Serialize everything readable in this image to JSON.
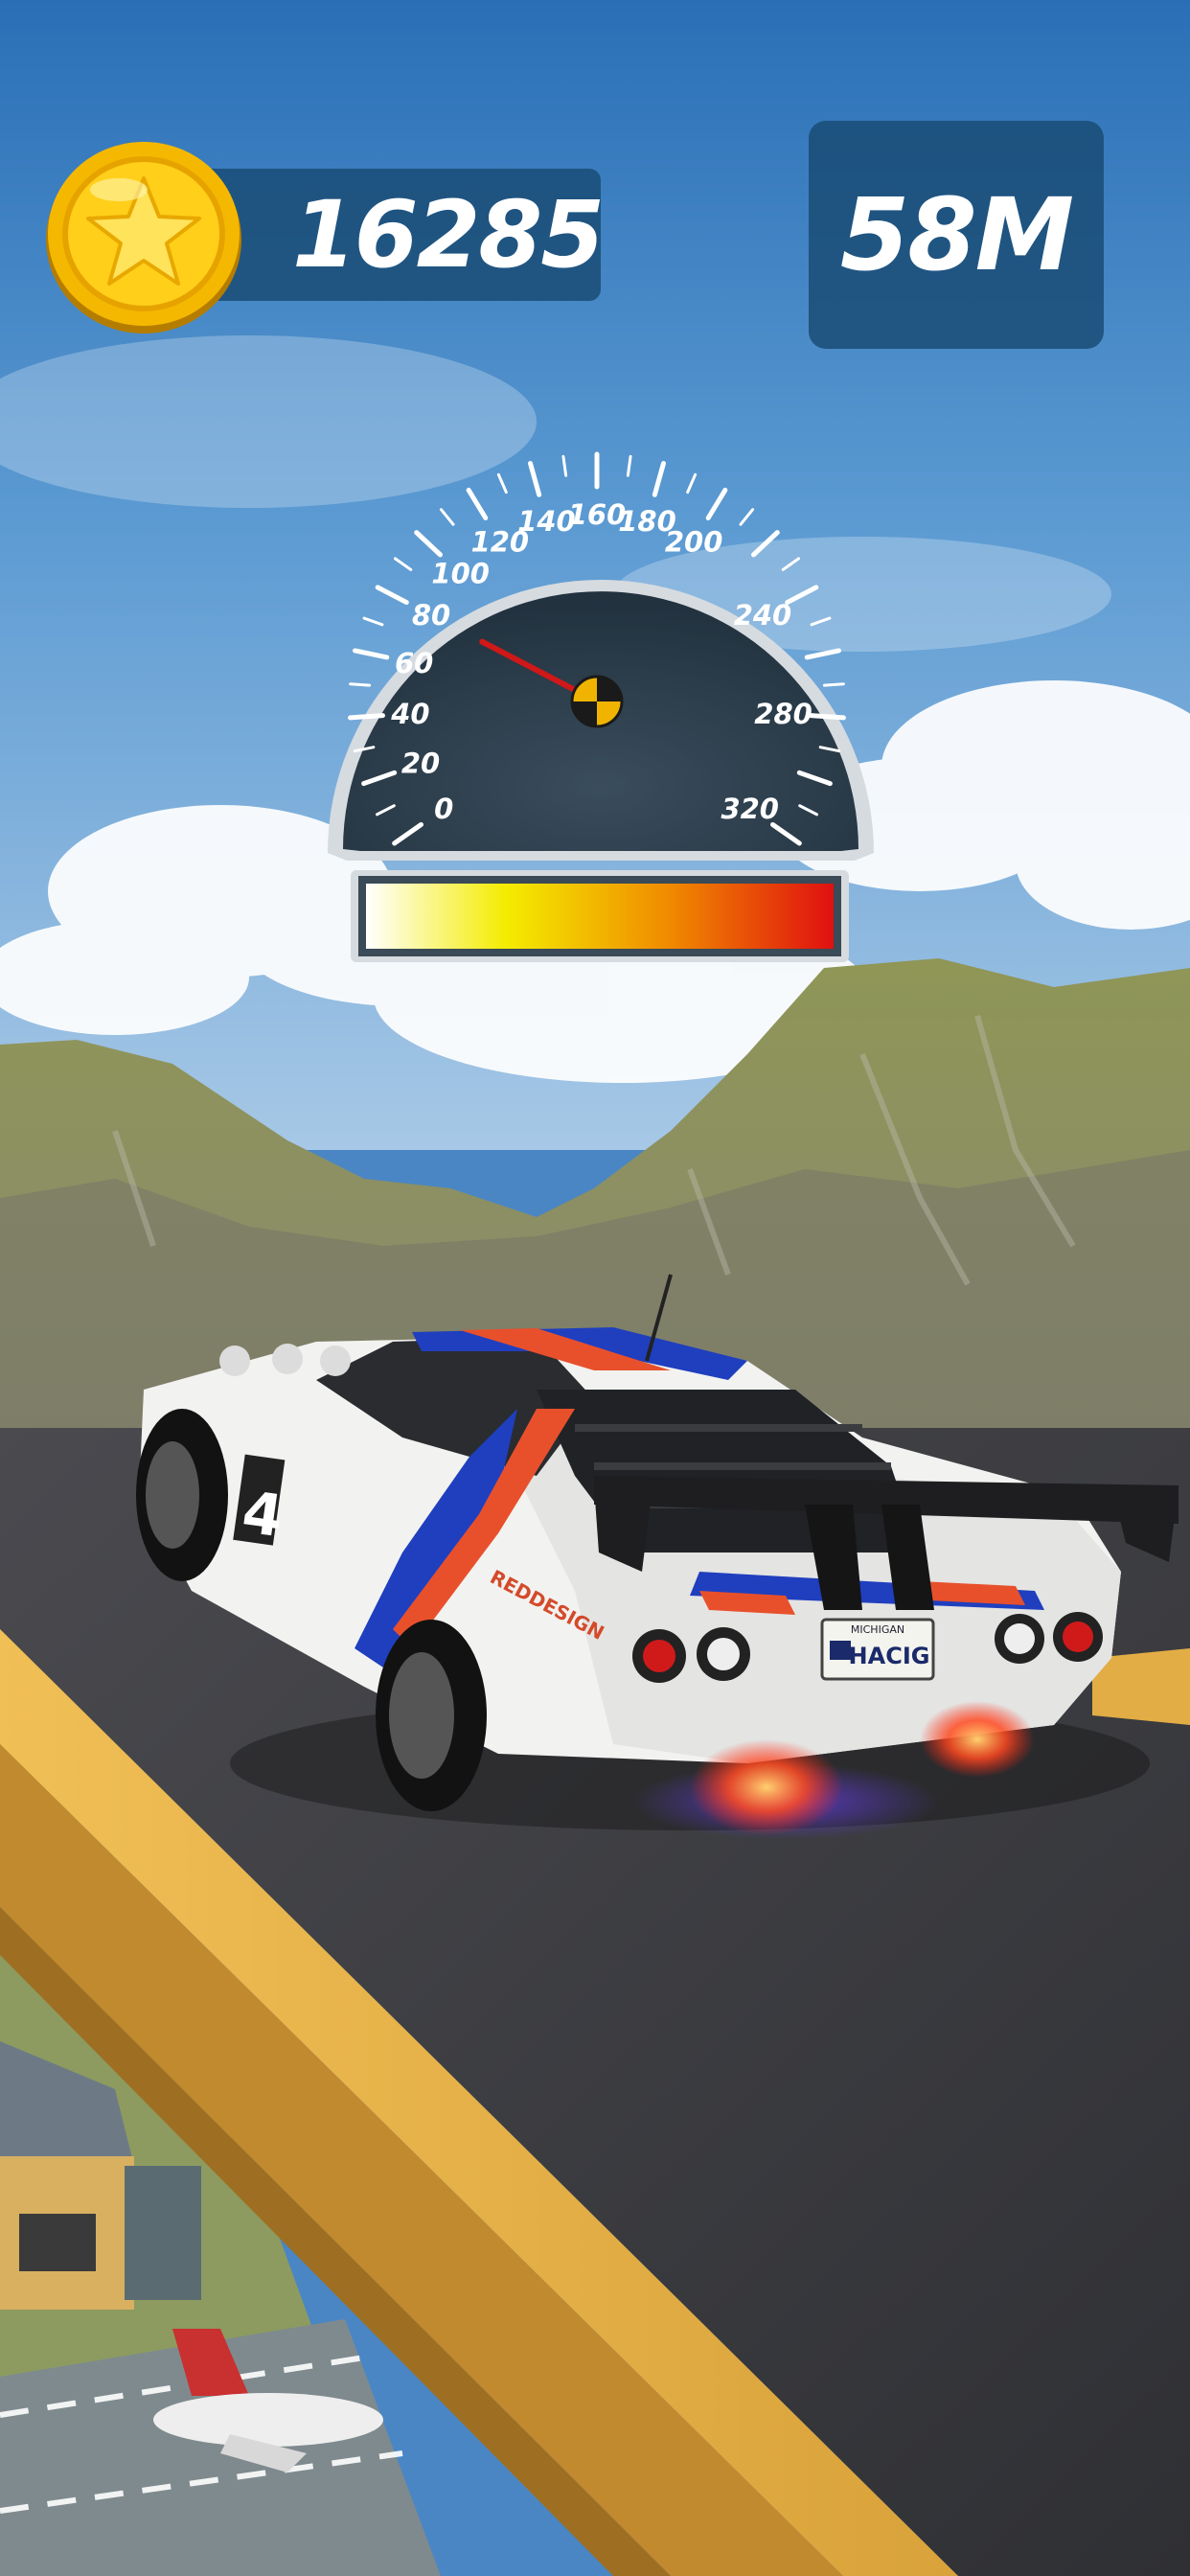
{
  "hud": {
    "coins": "16285",
    "distance": "58M"
  },
  "speedometer": {
    "current_speed": 80,
    "max_speed": 320,
    "tick_labels": [
      "0",
      "20",
      "40",
      "60",
      "80",
      "100",
      "120",
      "140",
      "160",
      "180",
      "200",
      "240",
      "280",
      "320"
    ],
    "boost_level": 1.0
  },
  "car": {
    "number": "4",
    "plate_state": "MICHIGAN",
    "plate_text": "HACIG",
    "side_text": "REDDESIGN"
  },
  "icons": [
    "coin-star-icon",
    "needle-hub-icon"
  ],
  "colors": {
    "hud_panel": "#194b73",
    "coin_gold": "#f5b800",
    "gauge_face": "#2b3d4d",
    "needle": "#d01818",
    "track_barrier": "#e2ad45",
    "road": "#3c3c40"
  }
}
